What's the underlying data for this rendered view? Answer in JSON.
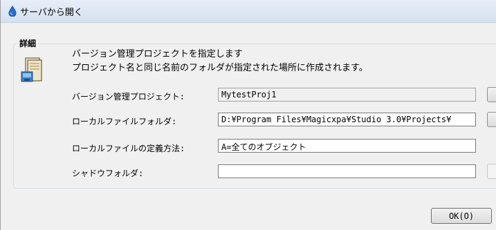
{
  "window": {
    "title": "サーバから開く"
  },
  "details": {
    "group_label": "詳細",
    "description_line1": "バージョン管理プロジェクトを指定します",
    "description_line2": "プロジェクト名と同じ名前のフォルダが指定された場所に作成されます。"
  },
  "fields": [
    {
      "label": "バージョン管理プロジェクト:",
      "value": "MytestProj1",
      "readonly": true
    },
    {
      "label": "ローカルファイルフォルダ:",
      "value": "D:¥Program Files¥Magicxpa¥Studio 3.0¥Projects¥",
      "readonly": false
    },
    {
      "label": "ローカルファイルの定義方法:",
      "value": "A=全てのオブジェクト",
      "readonly": false
    },
    {
      "label": "シャドウフォルダ:",
      "value": "",
      "readonly": false
    }
  ],
  "buttons": {
    "ok_label": "OK(O)"
  },
  "icons": {
    "title_icon": "magic-drop-icon",
    "details_icon": "project-folder-icon"
  }
}
